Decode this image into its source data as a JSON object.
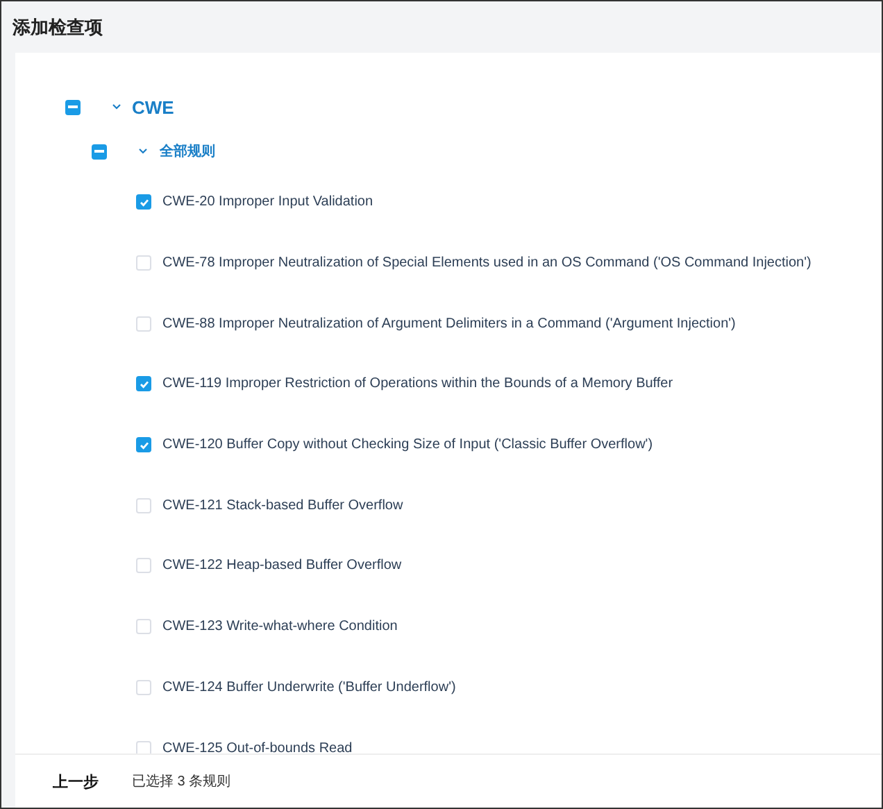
{
  "dialog": {
    "title": "添加检查项"
  },
  "tree": [
    {
      "label": "CWE",
      "indeterminate": true,
      "expanded": true,
      "children": [
        {
          "label": "全部规则",
          "indeterminate": true,
          "expanded": true,
          "children": [
            {
              "label": "CWE-20 Improper Input Validation",
              "checked": true
            },
            {
              "label": "CWE-78 Improper Neutralization of Special Elements used in an OS Command ('OS Command Injection')",
              "checked": false
            },
            {
              "label": "CWE-88 Improper Neutralization of Argument Delimiters in a Command ('Argument Injection')",
              "checked": false
            },
            {
              "label": "CWE-119 Improper Restriction of Operations within the Bounds of a Memory Buffer",
              "checked": true
            },
            {
              "label": "CWE-120 Buffer Copy without Checking Size of Input ('Classic Buffer Overflow')",
              "checked": true
            },
            {
              "label": "CWE-121 Stack-based Buffer Overflow",
              "checked": false
            },
            {
              "label": "CWE-122 Heap-based Buffer Overflow",
              "checked": false
            },
            {
              "label": "CWE-123 Write-what-where Condition",
              "checked": false
            },
            {
              "label": "CWE-124 Buffer Underwrite ('Buffer Underflow')",
              "checked": false
            },
            {
              "label": "CWE-125 Out-of-bounds Read",
              "checked": false
            }
          ]
        }
      ]
    }
  ],
  "footer": {
    "back_button": "上一步",
    "selection_summary": "已选择 3 条规则"
  }
}
